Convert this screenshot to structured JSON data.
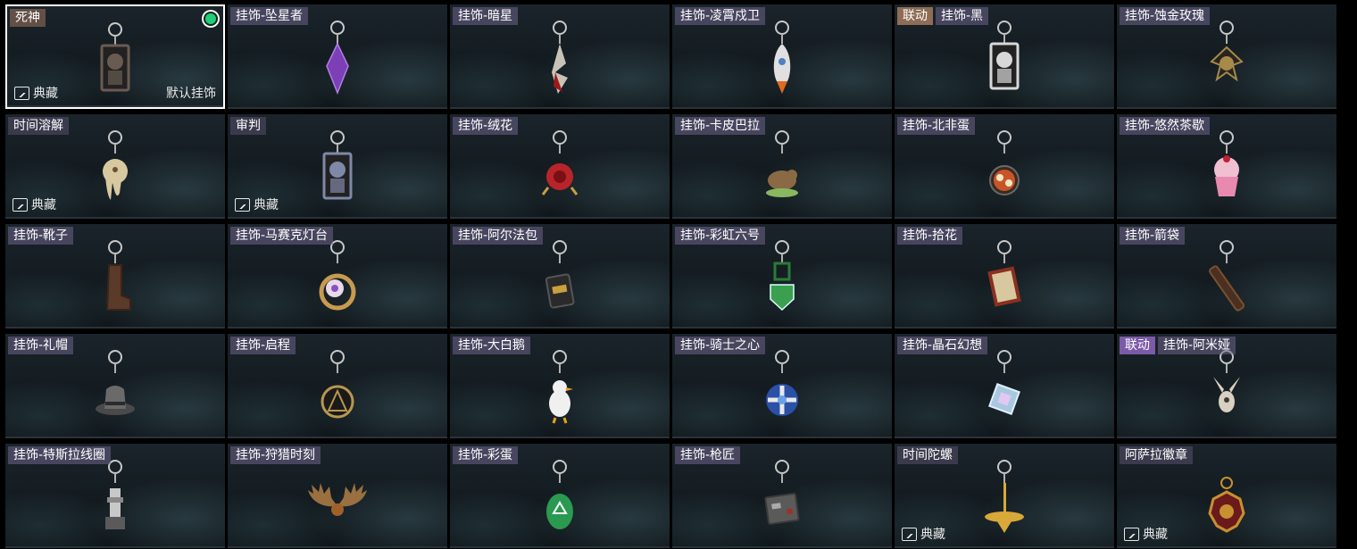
{
  "items": [
    {
      "tags": [
        {
          "text": "死神",
          "kind": "name"
        }
      ],
      "collection": "典藏",
      "default_label": "默认挂饰",
      "selected": true,
      "equipped": true,
      "icon": "tarot-reaper-charm-icon",
      "color": "#6a5b52",
      "shape": "card"
    },
    {
      "tags": [
        {
          "text": "挂饰-坠星者",
          "kind": "name"
        }
      ],
      "icon": "purple-crystal-charm-icon",
      "color": "#7c3fb8",
      "shape": "crystal"
    },
    {
      "tags": [
        {
          "text": "挂饰-暗星",
          "kind": "name"
        }
      ],
      "icon": "dark-star-charm-icon",
      "color": "#c8c3b8",
      "shape": "star"
    },
    {
      "tags": [
        {
          "text": "挂饰-凌霄戍卫",
          "kind": "name"
        }
      ],
      "icon": "rocket-charm-icon",
      "color": "#e0e0e0",
      "shape": "rocket"
    },
    {
      "tags": [
        {
          "text": "联动",
          "kind": "collab"
        },
        {
          "text": "挂饰-黑",
          "kind": "name"
        }
      ],
      "icon": "card-charm-icon",
      "color": "#d8d8d8",
      "shape": "card"
    },
    {
      "tags": [
        {
          "text": "挂饰-蚀金玫瑰",
          "kind": "name"
        }
      ],
      "icon": "golden-rose-charm-icon",
      "color": "#a58a4a",
      "shape": "rose"
    },
    {
      "tags": [
        {
          "text": "时间溶解",
          "kind": "name-only"
        }
      ],
      "collection": "典藏",
      "icon": "melting-clock-charm-icon",
      "color": "#d8c8a0",
      "shape": "melt"
    },
    {
      "tags": [
        {
          "text": "审判",
          "kind": "name-only"
        }
      ],
      "collection": "典藏",
      "icon": "tarot-judgement-charm-icon",
      "color": "#8088a8",
      "shape": "card"
    },
    {
      "tags": [
        {
          "text": "挂饰-绒花",
          "kind": "name"
        }
      ],
      "icon": "red-flower-charm-icon",
      "color": "#b8242a",
      "shape": "flower"
    },
    {
      "tags": [
        {
          "text": "挂饰-卡皮巴拉",
          "kind": "name"
        }
      ],
      "icon": "capybara-charm-icon",
      "color": "#8a6a45",
      "shape": "capy"
    },
    {
      "tags": [
        {
          "text": "挂饰-北非蛋",
          "kind": "name"
        }
      ],
      "icon": "pan-egg-charm-icon",
      "color": "#c8552a",
      "shape": "pan"
    },
    {
      "tags": [
        {
          "text": "挂饰-悠然茶歇",
          "kind": "name"
        }
      ],
      "icon": "cupcake-charm-icon",
      "color": "#e88ab0",
      "shape": "cupcake"
    },
    {
      "tags": [
        {
          "text": "挂饰-靴子",
          "kind": "name"
        }
      ],
      "icon": "boot-charm-icon",
      "color": "#5a3a28",
      "shape": "boot"
    },
    {
      "tags": [
        {
          "text": "挂饰-马赛克灯台",
          "kind": "name"
        }
      ],
      "icon": "moon-lamp-charm-icon",
      "color": "#c89a50",
      "shape": "moon"
    },
    {
      "tags": [
        {
          "text": "挂饰-阿尔法包",
          "kind": "name"
        }
      ],
      "icon": "bag-charm-icon",
      "color": "#2a2a2a",
      "shape": "bag"
    },
    {
      "tags": [
        {
          "text": "挂饰-彩虹六号",
          "kind": "name"
        }
      ],
      "icon": "green-shield-charm-icon",
      "color": "#3aa050",
      "shape": "shield"
    },
    {
      "tags": [
        {
          "text": "挂饰-拾花",
          "kind": "name"
        }
      ],
      "icon": "picture-frame-charm-icon",
      "color": "#8a3020",
      "shape": "frame"
    },
    {
      "tags": [
        {
          "text": "挂饰-箭袋",
          "kind": "name"
        }
      ],
      "icon": "quiver-charm-icon",
      "color": "#4a3020",
      "shape": "quiver"
    },
    {
      "tags": [
        {
          "text": "挂饰-礼帽",
          "kind": "name"
        }
      ],
      "icon": "hat-charm-icon",
      "color": "#6a6a6a",
      "shape": "hat"
    },
    {
      "tags": [
        {
          "text": "挂饰-启程",
          "kind": "name"
        }
      ],
      "icon": "compass-charm-icon",
      "color": "#b89850",
      "shape": "ring"
    },
    {
      "tags": [
        {
          "text": "挂饰-大白鹅",
          "kind": "name"
        }
      ],
      "icon": "goose-charm-icon",
      "color": "#f0f0f0",
      "shape": "goose"
    },
    {
      "tags": [
        {
          "text": "挂饰-骑士之心",
          "kind": "name"
        }
      ],
      "icon": "blue-cross-charm-icon",
      "color": "#2a50a8",
      "shape": "cross"
    },
    {
      "tags": [
        {
          "text": "挂饰-晶石幻想",
          "kind": "name"
        }
      ],
      "icon": "crystal-cube-charm-icon",
      "color": "#a8c8e0",
      "shape": "cube"
    },
    {
      "tags": [
        {
          "text": "联动",
          "kind": "collab-purple"
        },
        {
          "text": "挂饰-阿米娅",
          "kind": "name"
        }
      ],
      "icon": "bunny-charm-icon",
      "color": "#d8d0c0",
      "shape": "bunny"
    },
    {
      "tags": [
        {
          "text": "挂饰-特斯拉线圈",
          "kind": "name"
        }
      ],
      "icon": "tesla-coil-charm-icon",
      "color": "#c8c8c8",
      "shape": "coil"
    },
    {
      "tags": [
        {
          "text": "挂饰-狩猎时刻",
          "kind": "name"
        }
      ],
      "icon": "antlers-charm-icon",
      "color": "#9a7040",
      "shape": "antlers"
    },
    {
      "tags": [
        {
          "text": "挂饰-彩蛋",
          "kind": "name"
        }
      ],
      "icon": "green-egg-charm-icon",
      "color": "#2a9a50",
      "shape": "egg"
    },
    {
      "tags": [
        {
          "text": "挂饰-枪匠",
          "kind": "name"
        }
      ],
      "icon": "toolbox-charm-icon",
      "color": "#5a5a5a",
      "shape": "box"
    },
    {
      "tags": [
        {
          "text": "时间陀螺",
          "kind": "name-only"
        }
      ],
      "collection": "典藏",
      "icon": "spinning-top-charm-icon",
      "color": "#d8a838",
      "shape": "top"
    },
    {
      "tags": [
        {
          "text": "阿萨拉徽章",
          "kind": "name-only"
        }
      ],
      "collection": "典藏",
      "icon": "medallion-charm-icon",
      "color": "#c89030",
      "shape": "medal"
    }
  ]
}
